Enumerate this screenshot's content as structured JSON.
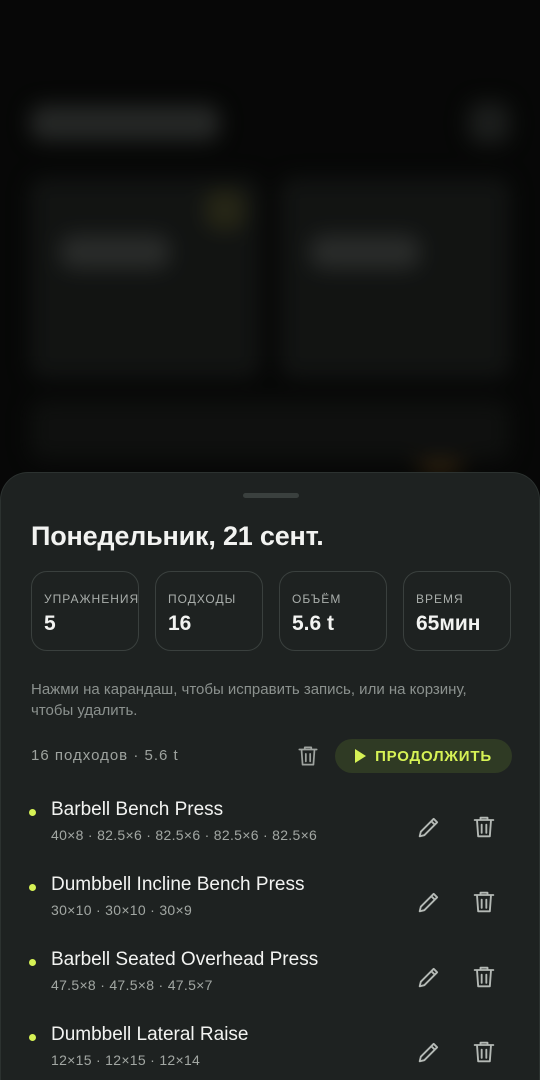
{
  "sheet": {
    "title": "Понедельник, 21 сент.",
    "stats": [
      {
        "label": "УПРАЖНЕНИЯ",
        "value": "5"
      },
      {
        "label": "ПОДХОДЫ",
        "value": "16"
      },
      {
        "label": "ОБЪЁМ",
        "value": "5.6 t"
      },
      {
        "label": "ВРЕМЯ",
        "value": "65мин"
      }
    ],
    "hint": "Нажми на карандаш, чтобы исправить запись, или на корзину, чтобы удалить.",
    "summary": "16 подходов · 5.6 t",
    "continue_label": "ПРОДОЛЖИТЬ",
    "exercises": [
      {
        "name": "Barbell Bench Press",
        "sets": "40×8 · 82.5×6 · 82.5×6 · 82.5×6 · 82.5×6"
      },
      {
        "name": "Dumbbell Incline Bench Press",
        "sets": "30×10 · 30×10 · 30×9"
      },
      {
        "name": "Barbell Seated Overhead Press",
        "sets": "47.5×8 · 47.5×8 · 47.5×7"
      },
      {
        "name": "Dumbbell Lateral Raise",
        "sets": "12×15 · 12×15 · 12×14"
      }
    ]
  },
  "colors": {
    "accent": "#d6f255",
    "sheet": "#1e2221",
    "text": "#f2f3f1"
  },
  "icons": {
    "edit": "pencil-icon",
    "delete": "trash-icon",
    "continue": "play-icon"
  }
}
